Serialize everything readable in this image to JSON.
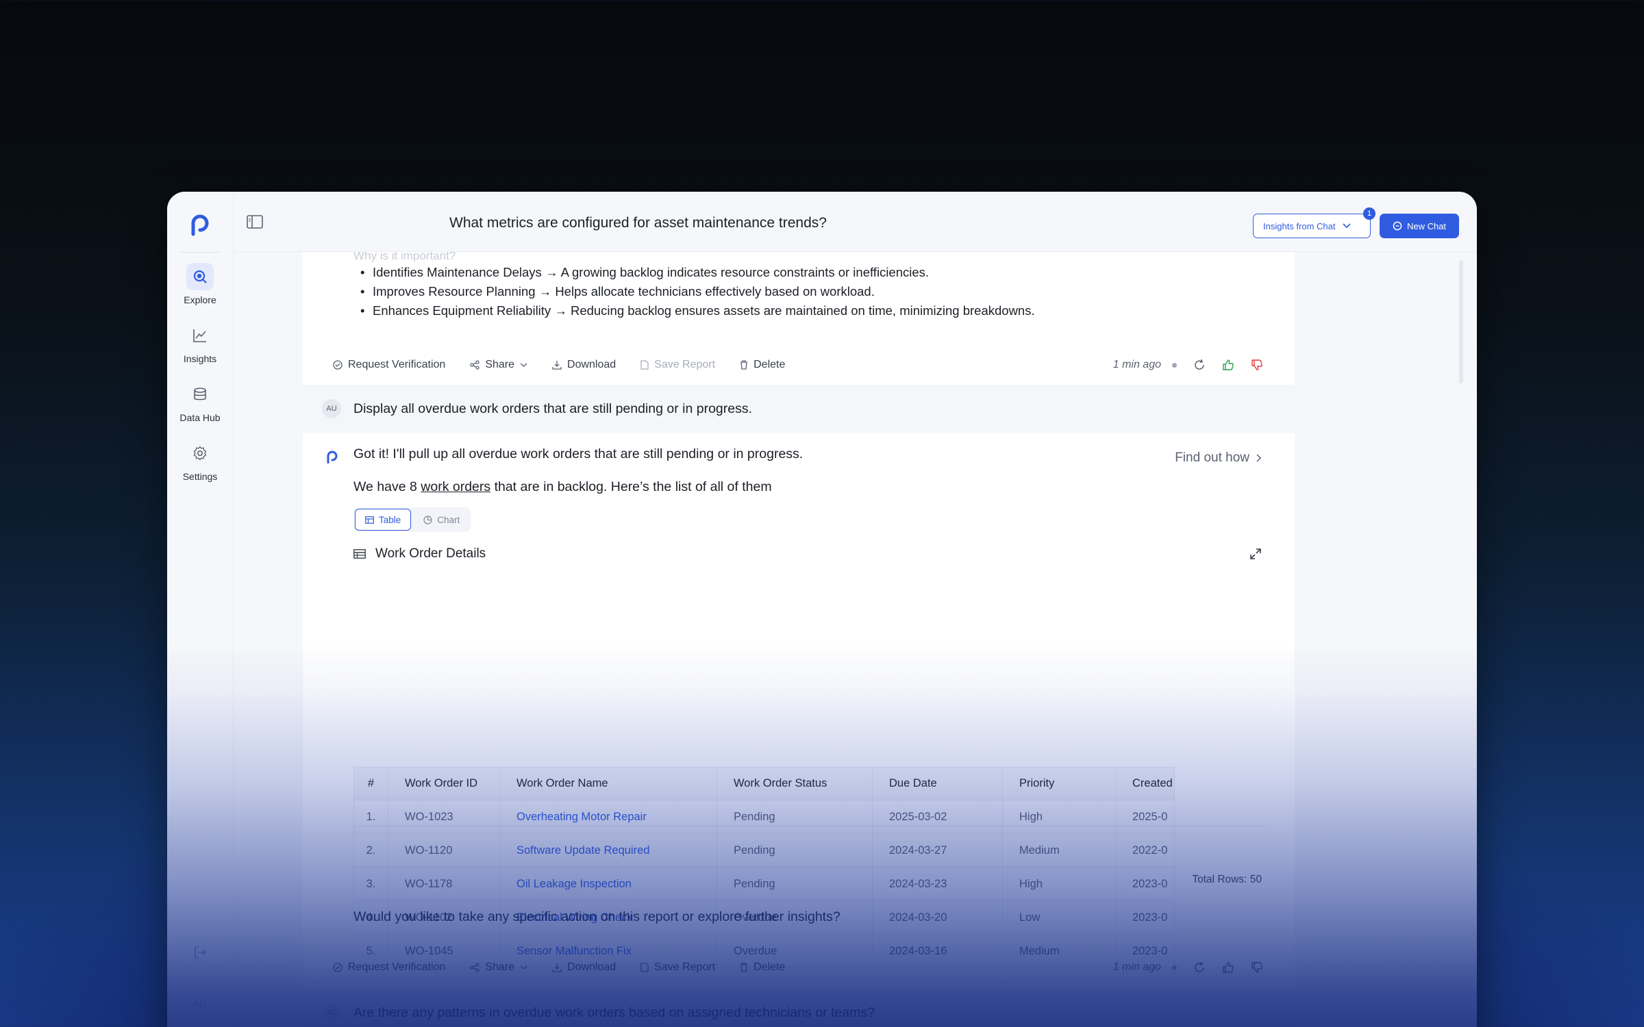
{
  "sidebar": {
    "items": [
      {
        "label": "Explore",
        "icon": "search-icon"
      },
      {
        "label": "Insights",
        "icon": "trend-chart-icon"
      },
      {
        "label": "Data Hub",
        "icon": "database-icon"
      },
      {
        "label": "Settings",
        "icon": "gear-icon"
      }
    ],
    "avatar": "AU"
  },
  "header": {
    "title": "What metrics are configured for asset maintenance trends?",
    "insights_btn": "Insights from Chat",
    "insights_badge": "1",
    "new_chat": "New Chat"
  },
  "feed": {
    "clipped_heading": "Why is it important?",
    "bullets": [
      "Identifies Maintenance Delays → A growing backlog indicates resource constraints or inefficiencies.",
      "Improves Resource Planning → Helps allocate technicians effectively based on workload.",
      "Enhances Equipment Reliability → Reducing backlog ensures assets are maintained on time, minimizing breakdowns."
    ],
    "actions": {
      "request_verification": "Request Verification",
      "share": "Share",
      "download": "Download",
      "save_report": "Save Report",
      "delete": "Delete",
      "time_ago": "1 min ago"
    },
    "user_avatar": "AU",
    "user_message": "Display all overdue work orders that are still pending or in progress.",
    "bot_intro": "Got it! I'll pull up all overdue work orders that are still pending or in progress.",
    "find_out_how": "Find out how",
    "bot_summary_pre": "We have 8 ",
    "bot_summary_link": "work orders",
    "bot_summary_post": " that are in backlog. Here’s the list of all of them",
    "tabs": {
      "table": "Table",
      "chart": "Chart"
    },
    "section_title": "Work Order Details",
    "table": {
      "headers": [
        "#",
        "Work Order ID",
        "Work Order Name",
        "Work Order Status",
        "Due Date",
        "Priority",
        "Created"
      ],
      "rows": [
        [
          "1.",
          "WO-1023",
          "Overheating Motor Repair",
          "Pending",
          "2025-03-02",
          "High",
          "2025-0"
        ],
        [
          "2.",
          "WO-1120",
          "Software Update Required",
          "Pending",
          "2024-03-27",
          "Medium",
          "2022-0"
        ],
        [
          "3.",
          "WO-1178",
          "Oil Leakage Inspection",
          "Pending",
          "2024-03-23",
          "High",
          "2023-0"
        ],
        [
          "4.",
          "WO-1102",
          "Electrical Wiring Check",
          "Overdue",
          "2024-03-20",
          "Low",
          "2023-0"
        ],
        [
          "5.",
          "WO-1045",
          "Sensor Malfunction Fix",
          "Overdue",
          "2024-03-16",
          "Medium",
          "2023-0"
        ]
      ],
      "total_rows": "Total Rows: 50"
    },
    "follow_up": "Would you like to take any specific action on this report or explore further insights?",
    "next_user_message": "Are there any patterns in overdue work orders based on assigned technicians or teams?"
  }
}
